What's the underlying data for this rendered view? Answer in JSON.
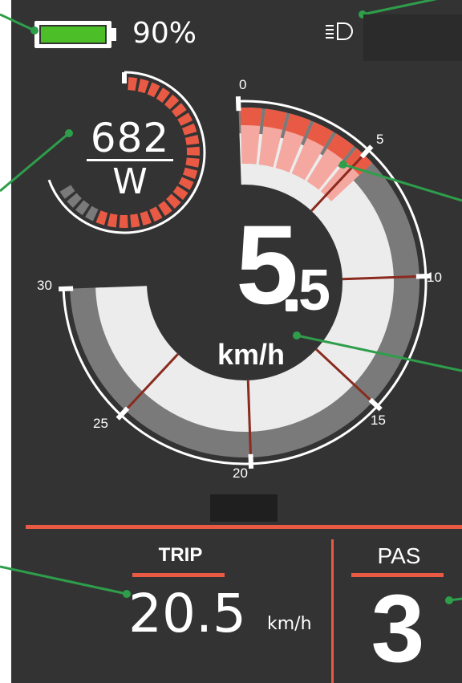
{
  "colors": {
    "background": "#333333",
    "accent": "#e85a44",
    "battery_fill": "#4cbf28",
    "callout_line": "#2e9e4b",
    "power_arc_active": "#e85a44",
    "power_arc_inactive": "#7a7a7a",
    "speed_arc_light": "#ececec",
    "speed_arc_dark": "#7a7a7a",
    "speed_arc_active": "#f4a8a0"
  },
  "status_bar": {
    "battery_level_fraction": 0.9,
    "battery_percent": "90%",
    "headlight_icon": "headlight-icon"
  },
  "power_gauge": {
    "value": "682",
    "unit": "W",
    "active_segments": 22,
    "total_segments": 26
  },
  "speed_gauge": {
    "value_int": "5",
    "value_dec": "5",
    "unit": "km/h",
    "speed": 5.5,
    "min": 0,
    "max": 30,
    "ticks": [
      "0",
      "5",
      "10",
      "15",
      "20",
      "25",
      "30"
    ]
  },
  "trip": {
    "label": "TRIP",
    "value": "20.5",
    "unit": "km/h"
  },
  "pas": {
    "label": "PAS",
    "value": "3"
  }
}
